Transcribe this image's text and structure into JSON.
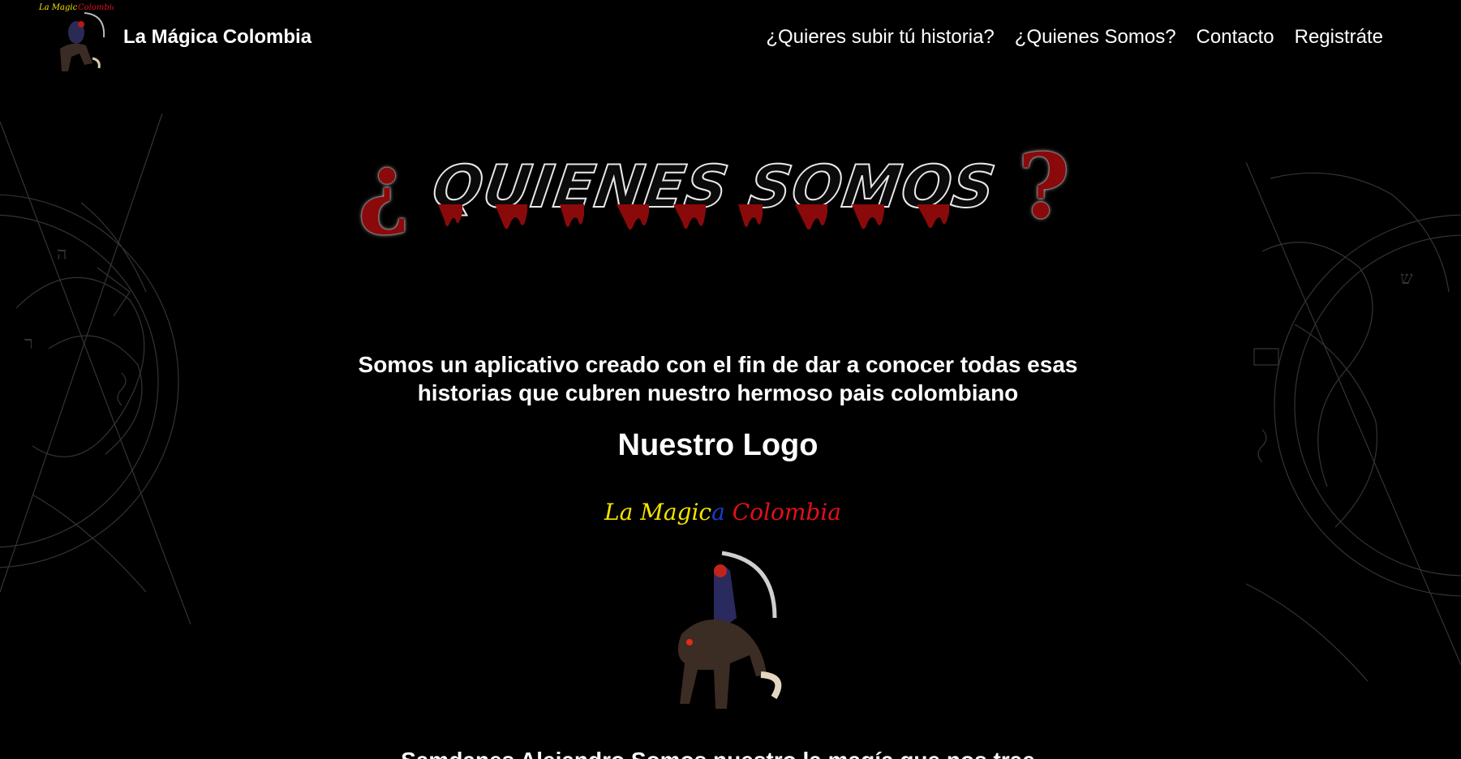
{
  "brand": {
    "name": "La Mágica Colombia",
    "logo_icon": "headless-rider-logo-icon"
  },
  "nav": {
    "items": [
      {
        "label": "¿Quieres subir tú historia?"
      },
      {
        "label": "¿Quienes Somos?"
      },
      {
        "label": "Contacto"
      },
      {
        "label": "Registráte"
      }
    ]
  },
  "hero": {
    "open_mark": "¿",
    "title": "QUIENES SOMOS",
    "close_mark": "?"
  },
  "intro": {
    "line1": "Somos un aplicativo creado con el fin de dar a conocer todas esas",
    "line2": "historias que cubren nuestro hermoso pais colombiano"
  },
  "logo_section": {
    "heading": "Nuestro Logo",
    "logo_text_parts": [
      "La Magic",
      "a",
      " Colombia"
    ]
  },
  "cut_text": "Samdanes Alejandro Somos nuestro la magía que nos trae",
  "colors": {
    "background": "#000000",
    "text": "#ffffff",
    "blood": "#8a0a0c",
    "logo_yellow": "#f5e300",
    "logo_blue": "#1a3ccf",
    "logo_red": "#e3101a"
  }
}
